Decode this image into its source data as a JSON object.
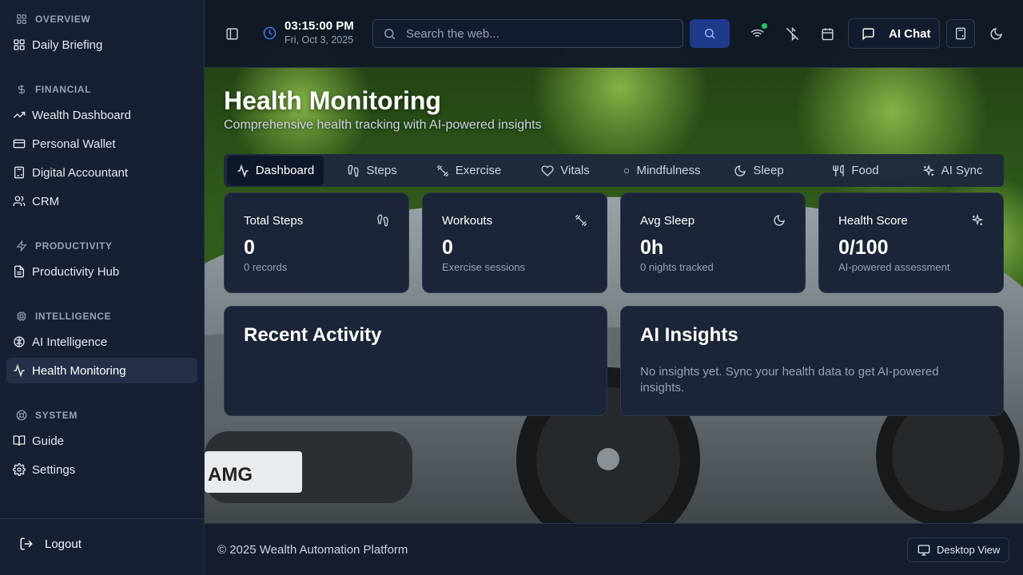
{
  "sidebar": {
    "sections": [
      {
        "label": "OVERVIEW",
        "icon": "grid-icon",
        "items": [
          {
            "label": "Daily Briefing",
            "icon": "grid-icon"
          }
        ]
      },
      {
        "label": "FINANCIAL",
        "icon": "dollar-icon",
        "items": [
          {
            "label": "Wealth Dashboard",
            "icon": "trending-up-icon"
          },
          {
            "label": "Personal Wallet",
            "icon": "credit-card-icon"
          },
          {
            "label": "Digital Accountant",
            "icon": "calculator-icon"
          },
          {
            "label": "CRM",
            "icon": "users-icon"
          }
        ]
      },
      {
        "label": "PRODUCTIVITY",
        "icon": "zap-icon",
        "items": [
          {
            "label": "Productivity Hub",
            "icon": "file-text-icon"
          }
        ]
      },
      {
        "label": "INTELLIGENCE",
        "icon": "cpu-icon",
        "items": [
          {
            "label": "AI Intelligence",
            "icon": "brain-icon"
          },
          {
            "label": "Health Monitoring",
            "icon": "activity-icon",
            "active": true
          }
        ]
      },
      {
        "label": "SYSTEM",
        "icon": "life-buoy-icon",
        "items": [
          {
            "label": "Guide",
            "icon": "book-open-icon"
          },
          {
            "label": "Settings",
            "icon": "settings-icon"
          }
        ]
      }
    ],
    "logout_label": "Logout"
  },
  "header": {
    "time": "03:15:00 PM",
    "date": "Fri, Oct 3, 2025",
    "search_placeholder": "Search the web...",
    "chat_label": "AI Chat",
    "wifi_status_color": "#22c55e"
  },
  "page": {
    "title": "Health Monitoring",
    "subtitle": "Comprehensive health tracking with AI-powered insights"
  },
  "tabs": [
    {
      "label": "Dashboard",
      "icon": "activity-icon",
      "active": true
    },
    {
      "label": "Steps",
      "icon": "footprints-icon"
    },
    {
      "label": "Exercise",
      "icon": "dumbbell-icon"
    },
    {
      "label": "Vitals",
      "icon": "heart-icon"
    },
    {
      "label": "Mindfulness",
      "icon": "dot-icon"
    },
    {
      "label": "Sleep",
      "icon": "moon-icon"
    },
    {
      "label": "Food",
      "icon": "utensils-icon"
    },
    {
      "label": "AI Sync",
      "icon": "sparkles-icon"
    }
  ],
  "stats": [
    {
      "label": "Total Steps",
      "value": "0",
      "sub": "0 records",
      "icon": "footprints-icon"
    },
    {
      "label": "Workouts",
      "value": "0",
      "sub": "Exercise sessions",
      "icon": "dumbbell-icon"
    },
    {
      "label": "Avg Sleep",
      "value": "0h",
      "sub": "0 nights tracked",
      "icon": "moon-icon"
    },
    {
      "label": "Health Score",
      "value": "0/100",
      "sub": "AI-powered assessment",
      "icon": "sparkles-icon"
    }
  ],
  "panels": {
    "recent_activity_title": "Recent Activity",
    "insights_title": "AI Insights",
    "insights_text": "No insights yet. Sync your health data to get AI-powered insights."
  },
  "footer": {
    "copyright": "© 2025 Wealth Automation Platform",
    "view_label": "Desktop View"
  },
  "colors": {
    "accent": "#3b82f6",
    "sidebar_bg": "#172033",
    "card_bg": "#1b2537"
  }
}
